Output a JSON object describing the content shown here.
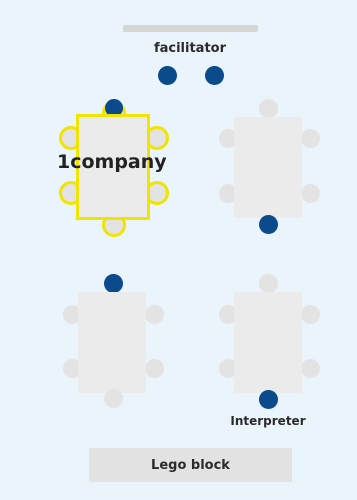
{
  "facilitator": {
    "label": "facilitator"
  },
  "group_1": {
    "label": "1company",
    "highlighted": true
  },
  "interpreter": {
    "label": "Interpreter"
  },
  "lego_block": {
    "label": "Lego block"
  },
  "colors": {
    "background": "#eaf4fb",
    "highlight": "#f0e400",
    "person": "#0b4a8b",
    "seat": "#e3e3e3",
    "table": "#ebebeb"
  }
}
